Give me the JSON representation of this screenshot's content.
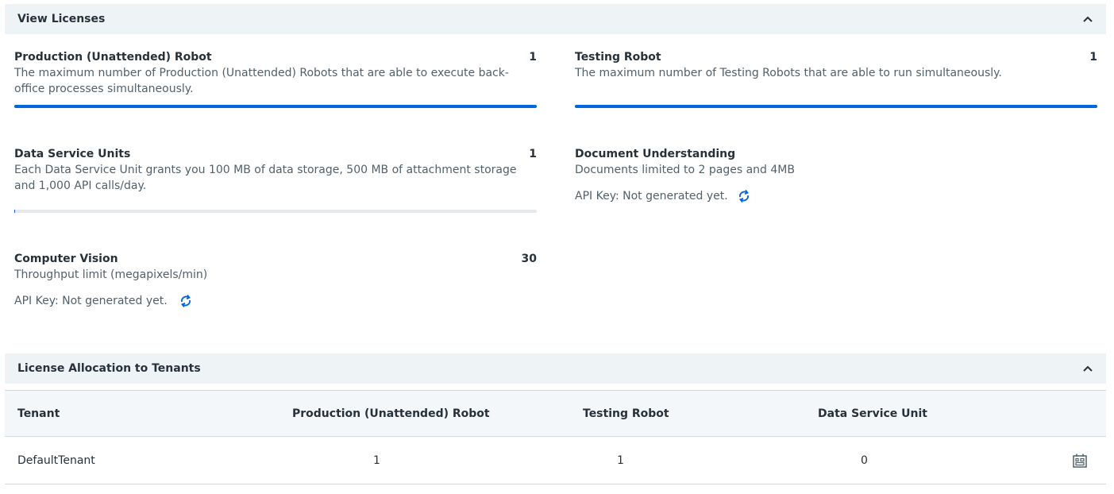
{
  "view_licenses": {
    "title": "View Licenses",
    "cards": {
      "production": {
        "title": "Production (Unattended) Robot",
        "count": "1",
        "description": "The maximum number of Production (Unattended) Robots that are able to execute back-office processes simultaneously.",
        "usage_fraction": 1.0
      },
      "testing": {
        "title": "Testing Robot",
        "count": "1",
        "description": "The maximum number of Testing Robots that are able to run simultaneously.",
        "usage_fraction": 1.0
      },
      "data_service": {
        "title": "Data Service Units",
        "count": "1",
        "description": "Each Data Service Unit grants you 100 MB of data storage, 500 MB of attachment storage and 1,000 API calls/day.",
        "usage_fraction": 0.0
      },
      "document_understanding": {
        "title": "Document Understanding",
        "description": "Documents limited to 2 pages and 4MB",
        "api_key": "API Key: Not generated yet."
      },
      "computer_vision": {
        "title": "Computer Vision",
        "count": "30",
        "description": "Throughput limit (megapixels/min)",
        "api_key": "API Key: Not generated yet."
      }
    }
  },
  "allocation": {
    "title": "License Allocation to Tenants",
    "columns": [
      "Tenant",
      "Production (Unattended) Robot",
      "Testing Robot",
      "Data Service Unit"
    ],
    "rows": [
      {
        "tenant": "DefaultTenant",
        "production": "1",
        "testing": "1",
        "data_service": "0"
      }
    ]
  },
  "icons": {
    "collapse": "chevron-up-icon",
    "refresh": "refresh-icon",
    "edit_allocation": "allocation-edit-icon"
  },
  "colors": {
    "accent": "#0067df",
    "header_bg": "#eef3f6"
  }
}
